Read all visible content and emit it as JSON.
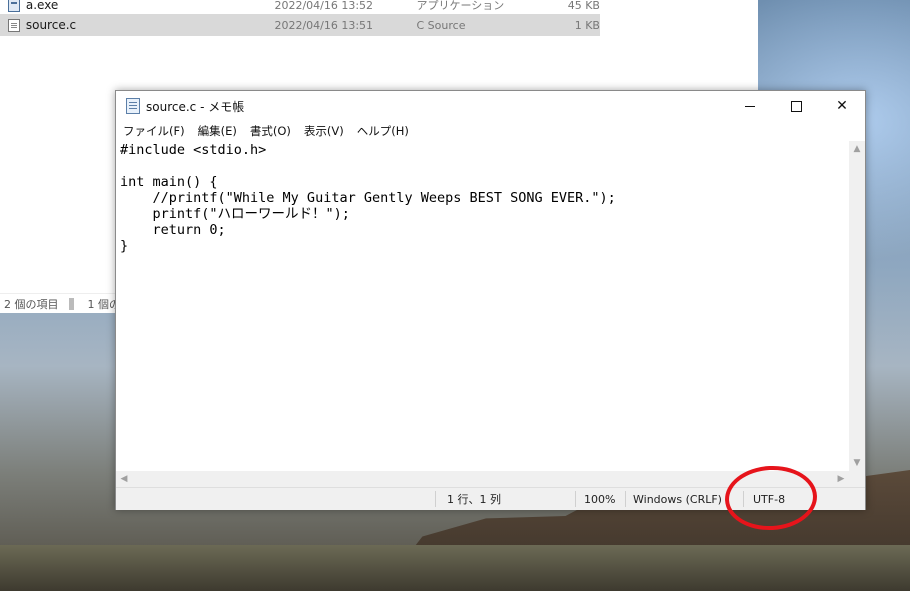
{
  "explorer": {
    "files": [
      {
        "name": "a.exe",
        "date": "2022/04/16 13:52",
        "type": "アプリケーション",
        "size": "45 KB",
        "icon": "exe-icon",
        "selected": false
      },
      {
        "name": "source.c",
        "date": "2022/04/16 13:51",
        "type": "C Source",
        "size": "1 KB",
        "icon": "c-source-file-icon",
        "selected": true
      }
    ],
    "status": {
      "items_count": "2 個の項目",
      "selected_count": "1 個の項"
    }
  },
  "notepad": {
    "title": "source.c - メモ帳",
    "menu": [
      "ファイル(F)",
      "編集(E)",
      "書式(O)",
      "表示(V)",
      "ヘルプ(H)"
    ],
    "content": "#include <stdio.h>\n\nint main() {\n    //printf(\"While My Guitar Gently Weeps BEST SONG EVER.\");\n    printf(\"ハローワールド！\");\n    return 0;\n}",
    "status": {
      "position": "1 行、1 列",
      "zoom": "100%",
      "line_ending": "Windows (CRLF)",
      "encoding": "UTF-8"
    }
  },
  "colors": {
    "annotation": "#e6141b",
    "selection": "#d9d9d9"
  }
}
